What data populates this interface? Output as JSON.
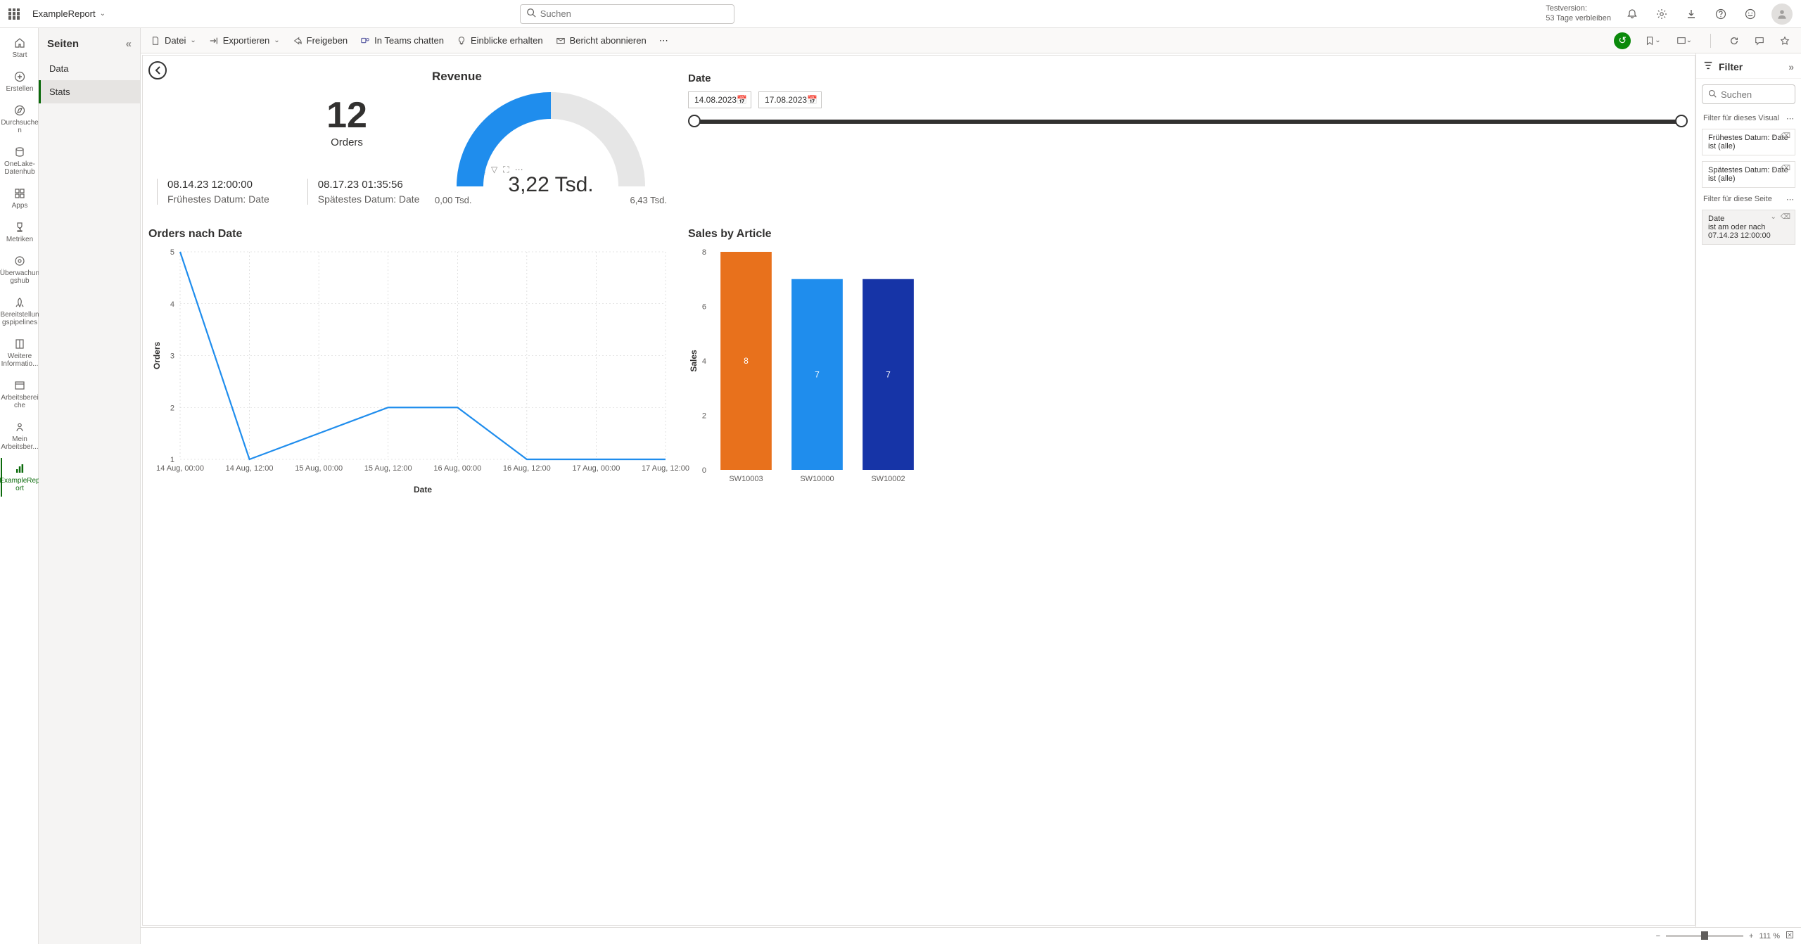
{
  "header": {
    "report_name": "ExampleReport",
    "search_placeholder": "Suchen",
    "trial_line1": "Testversion:",
    "trial_line2": "53 Tage verbleiben"
  },
  "nav_rail": [
    {
      "label": "Start"
    },
    {
      "label": "Erstellen"
    },
    {
      "label": "Durchsuche n"
    },
    {
      "label": "OneLake-Datenhub"
    },
    {
      "label": "Apps"
    },
    {
      "label": "Metriken"
    },
    {
      "label": "Überwachun gshub"
    },
    {
      "label": "Bereitstellun gspipelines"
    },
    {
      "label": "Weitere Informatio..."
    },
    {
      "label": "Arbeitsberei che"
    },
    {
      "label": "Mein Arbeitsber..."
    },
    {
      "label": "ExampleRep ort"
    }
  ],
  "pages": {
    "header": "Seiten",
    "items": [
      "Data",
      "Stats"
    ],
    "active": "Stats"
  },
  "toolbar": {
    "file": "Datei",
    "export": "Exportieren",
    "share": "Freigeben",
    "teams": "In Teams chatten",
    "insights": "Einblicke erhalten",
    "subscribe": "Bericht abonnieren"
  },
  "cards": {
    "orders": {
      "value": "12",
      "label": "Orders"
    },
    "dates": {
      "earliest": {
        "value": "08.14.23 12:00:00",
        "label": "Frühestes Datum: Date"
      },
      "latest": {
        "value": "08.17.23 01:35:56",
        "label": "Spätestes Datum: Date"
      }
    }
  },
  "gauge": {
    "title": "Revenue",
    "value": "3,22 Tsd.",
    "min": "0,00 Tsd.",
    "max": "6,43 Tsd.",
    "ratio": 0.5
  },
  "date_slicer": {
    "title": "Date",
    "from": "14.08.2023",
    "to": "17.08.2023"
  },
  "line_chart": {
    "title": "Orders nach Date",
    "xlabel": "Date",
    "ylabel": "Orders"
  },
  "bar_chart": {
    "title": "Sales by Article",
    "ylabel": "Sales"
  },
  "filters": {
    "title": "Filter",
    "search_placeholder": "Suchen",
    "visual_section": "Filter für dieses Visual",
    "visual_cards": [
      {
        "title": "Frühestes Datum: Date",
        "sub": "ist (alle)"
      },
      {
        "title": "Spätestes Datum: Date",
        "sub": "ist (alle)"
      }
    ],
    "page_section": "Filter für diese Seite",
    "page_cards": [
      {
        "title": "Date",
        "sub": "ist am oder nach 07.14.23 12:00:00"
      }
    ]
  },
  "zoom": {
    "value": "111 %"
  },
  "chart_data": [
    {
      "type": "gauge",
      "title": "Revenue",
      "value": 3.22,
      "min": 0.0,
      "max": 6.43,
      "unit": "Tsd."
    },
    {
      "type": "line",
      "title": "Orders nach Date",
      "xlabel": "Date",
      "ylabel": "Orders",
      "ylim": [
        1,
        5
      ],
      "x": [
        "14 Aug, 00:00",
        "14 Aug, 12:00",
        "15 Aug, 00:00",
        "15 Aug, 12:00",
        "16 Aug, 00:00",
        "16 Aug, 12:00",
        "17 Aug, 00:00",
        "17 Aug, 12:00"
      ],
      "values": [
        5,
        1,
        1.5,
        2,
        2,
        1,
        1,
        1
      ]
    },
    {
      "type": "bar",
      "title": "Sales by Article",
      "ylabel": "Sales",
      "ylim": [
        0,
        8
      ],
      "categories": [
        "SW10003",
        "SW10000",
        "SW10002"
      ],
      "values": [
        8,
        7,
        7
      ],
      "colors": [
        "#e8711c",
        "#1f8ded",
        "#1634a7"
      ]
    }
  ]
}
